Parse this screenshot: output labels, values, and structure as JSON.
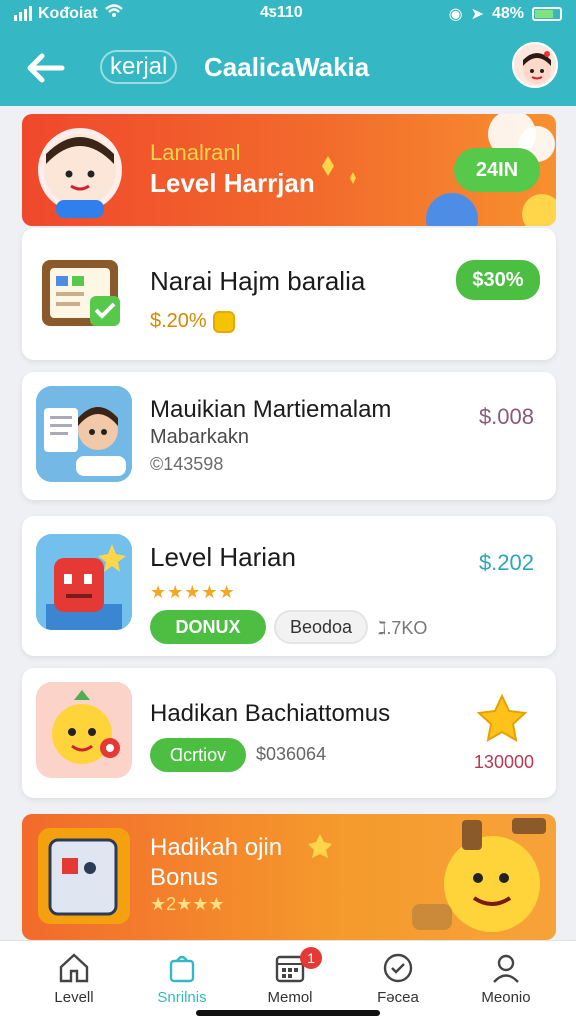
{
  "status": {
    "carrier": "Koᵭoiat",
    "time": "4ƽ110",
    "battery": "48%"
  },
  "appbar": {
    "pill_text": "kerjal",
    "title": "CaalicaWakia"
  },
  "banner_top": {
    "line1": "Lanalranl",
    "line2": "Level Harrjan",
    "badge": "24IN"
  },
  "cards": [
    {
      "title": "Narai Hajm baralia",
      "price_small": "$.20%",
      "pill": "$30%"
    },
    {
      "title": "Mauikian Martiemalam",
      "sub1": "Mabarkakn",
      "sub2": "©143598",
      "price": "$.008"
    },
    {
      "title": "Level Harian",
      "stars": "★★★★★",
      "price": "$.202",
      "pill1": "DONUX",
      "pill2": "Beodoa",
      "extra": "ℷ.7KO"
    },
    {
      "title": "Hadikan Bachiattomus",
      "pill": "Ɑcrtiov",
      "sub": "$036064",
      "price": "130000"
    }
  ],
  "banner_bottom": {
    "line1": "Hadikah ojin",
    "line2": "Bonus",
    "stars": "★2★★★"
  },
  "nav": [
    {
      "label": "Levell",
      "icon": "home-icon"
    },
    {
      "label": "Snrilnis",
      "icon": "shopping-bag-icon"
    },
    {
      "label": "Memol",
      "icon": "calendar-icon",
      "badge": "1"
    },
    {
      "label": "Fǝcea",
      "icon": "check-circle-icon"
    },
    {
      "label": "Meonio",
      "icon": "profile-icon"
    }
  ],
  "colors": {
    "primary": "#35b8c4",
    "green": "#4cbf43",
    "orange": "#f26a2c",
    "red": "#e53935",
    "gold": "#f5a623"
  }
}
